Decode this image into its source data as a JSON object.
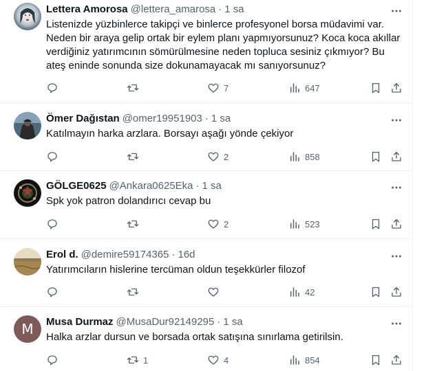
{
  "colors": {
    "text": "#0f1419",
    "secondary": "#536471",
    "divider": "#eff3f4"
  },
  "tweets": [
    {
      "name": "Lettera Amorosa",
      "handle": "@lettera_amarosa",
      "separator": "·",
      "time": "1 sa",
      "text": "Listenizde yüzbinlerce takipçi ve binlerce profesyonel borsa müdavimi var. Neden bir araya gelip ortak bir eylem planı yapmıyorsunuz? Koca koca akıllar verdiğiniz yatırımcının sömürülmesine neden topluca sesiniz çıkmıyor? Bu ateş eninde sonunda size dokunamayacak mı sanıyorsunuz?",
      "replies": "",
      "retweets": "",
      "likes": "7",
      "views": "647"
    },
    {
      "name": "Ömer Dağıstan",
      "handle": "@omer19951903",
      "separator": "·",
      "time": "1 sa",
      "text": "Katılmayın harka arzlara. Borsayı aşağı yönde çekiyor",
      "replies": "",
      "retweets": "",
      "likes": "2",
      "views": "858"
    },
    {
      "name": "GÖLGE0625",
      "handle": "@Ankara0625Eka",
      "separator": "·",
      "time": "1 sa",
      "text": "Spk yok patron dolandırıcı cevap bu",
      "replies": "",
      "retweets": "",
      "likes": "2",
      "views": "523"
    },
    {
      "name": "Erol d.",
      "handle": "@demire59174365",
      "separator": "·",
      "time": "16d",
      "text": "Yatırımcıların hislerine tercüman oldun teşekkürler filozof",
      "replies": "",
      "retweets": "",
      "likes": "",
      "views": "42"
    },
    {
      "name": "Musa Durmaz",
      "handle": "@MusaDur92149295",
      "separator": "·",
      "time": "1 sa",
      "avatar_letter": "M",
      "text": "Halka arzlar dursun ve borsada ortak satışına sınırlama getirilsin.",
      "replies": "",
      "retweets": "1",
      "likes": "4",
      "views": "854"
    }
  ],
  "icons": {
    "more": "more-dots-icon",
    "reply": "reply-icon",
    "retweet": "retweet-icon",
    "like": "heart-icon",
    "views": "views-chart-icon",
    "bookmark": "bookmark-icon",
    "share": "share-icon"
  }
}
